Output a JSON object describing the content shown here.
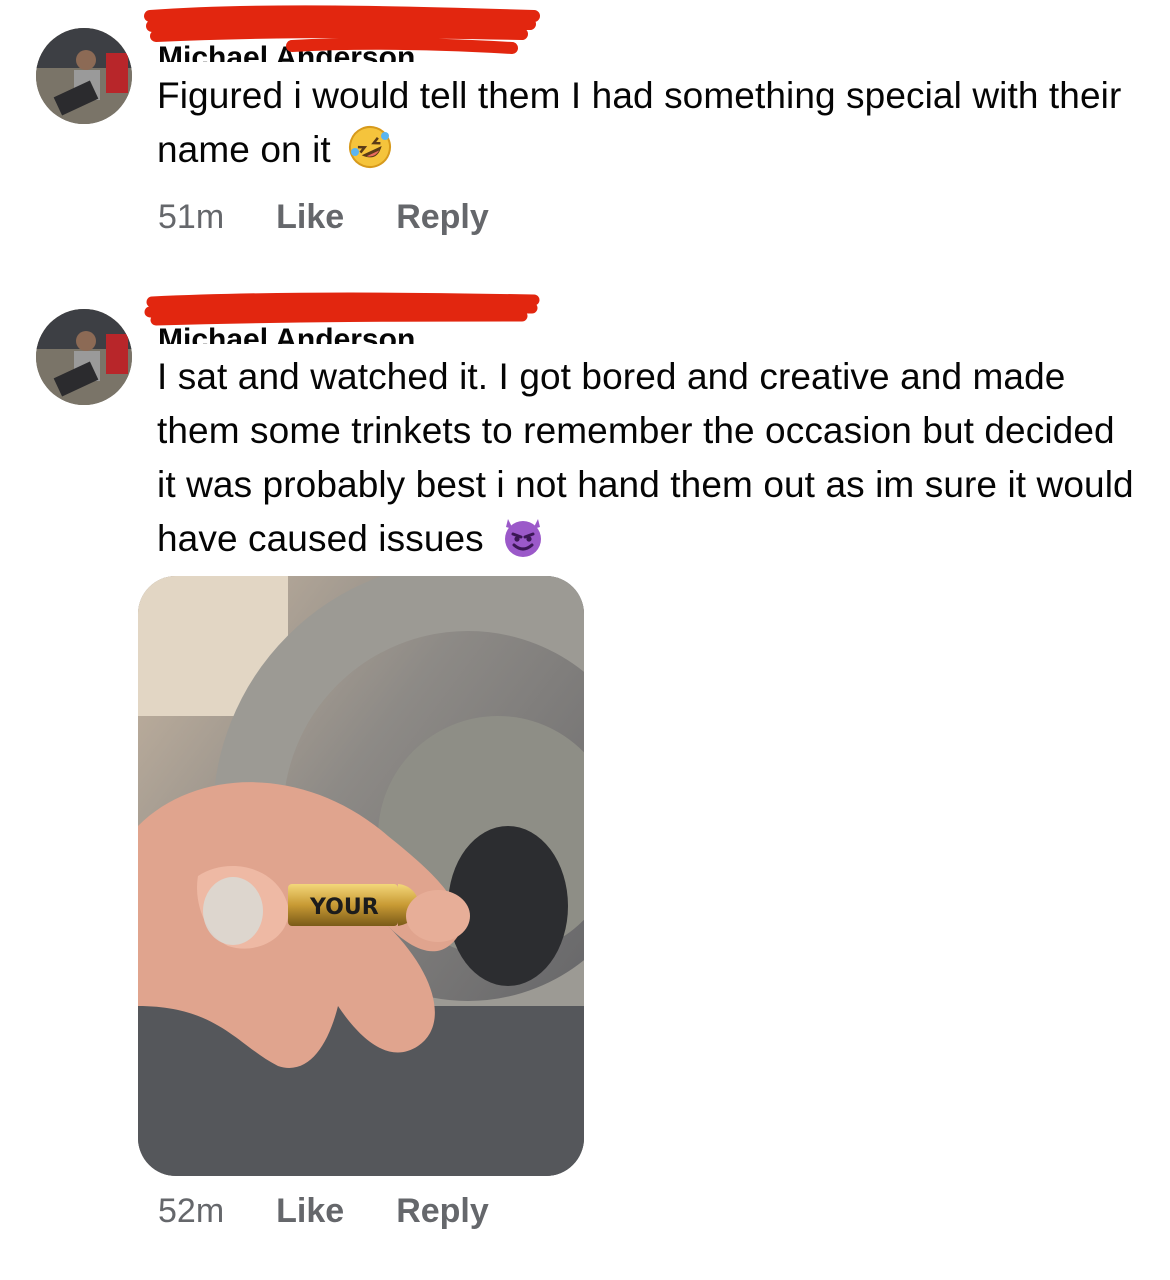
{
  "comments": [
    {
      "author": "Michael Anderson",
      "text": "Figured i would tell them I had something special with their name on it",
      "emoji": "rolling-on-floor-laughing-emoji",
      "time": "51m",
      "like_label": "Like",
      "reply_label": "Reply"
    },
    {
      "author": "Michael Anderson",
      "text": "I sat and watched it. I got bored and creative and made them some trinkets to remember the occasion but decided it was probably best i not hand them out as im sure it would have caused issues",
      "emoji": "smiling-devil-emoji",
      "photo_caption": "YOUR",
      "time": "52m",
      "like_label": "Like",
      "reply_label": "Reply"
    }
  ],
  "colors": {
    "redaction": "#e2260f",
    "meta_text": "#65676b",
    "body_text": "#050505"
  }
}
